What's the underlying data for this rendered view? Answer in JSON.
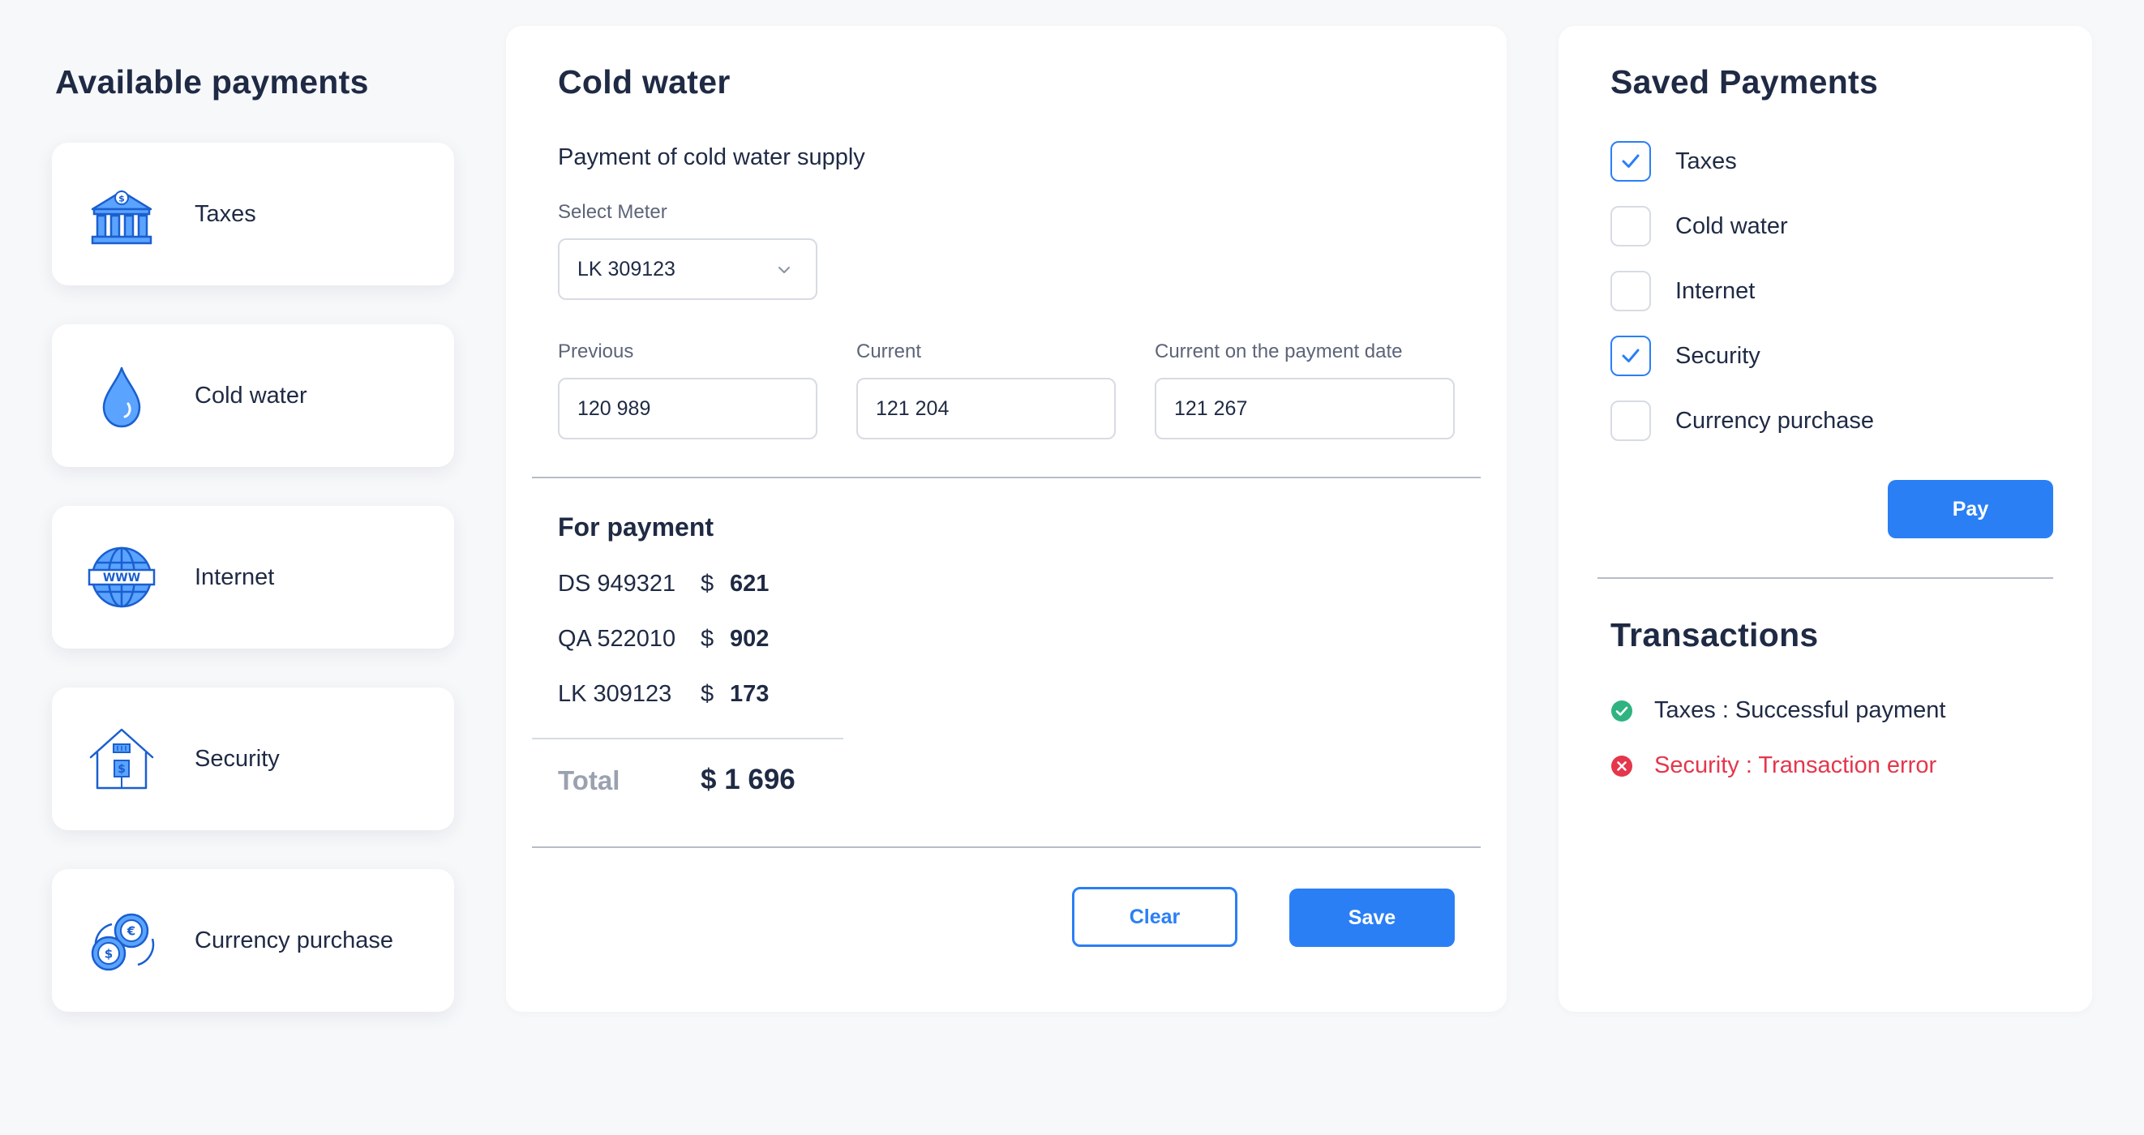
{
  "available_payments": {
    "title": "Available payments",
    "items": [
      {
        "label": "Taxes",
        "icon": "bank-icon"
      },
      {
        "label": "Cold water",
        "icon": "water-drop-icon"
      },
      {
        "label": "Internet",
        "icon": "globe-www-icon"
      },
      {
        "label": "Security",
        "icon": "house-safe-icon"
      },
      {
        "label": "Currency purchase",
        "icon": "coins-icon"
      }
    ]
  },
  "detail": {
    "title": "Cold water",
    "subtitle": "Payment of cold water supply",
    "meter": {
      "label": "Select Meter",
      "value": "LK 309123"
    },
    "readings": {
      "previous": {
        "label": "Previous",
        "value": "120 989"
      },
      "current": {
        "label": "Current",
        "value": "121 204"
      },
      "current_on_date": {
        "label": "Current on the payment date",
        "value": "121 267"
      }
    },
    "for_payment": {
      "title": "For payment",
      "rows": [
        {
          "id": "DS 949321",
          "currency": "$",
          "amount": "621"
        },
        {
          "id": "QA 522010",
          "currency": "$",
          "amount": "902"
        },
        {
          "id": "LK 309123",
          "currency": "$",
          "amount": "173"
        }
      ],
      "total_label": "Total",
      "total_value": "$ 1 696"
    },
    "buttons": {
      "clear": "Clear",
      "save": "Save"
    }
  },
  "saved_payments": {
    "title": "Saved Payments",
    "items": [
      {
        "label": "Taxes",
        "checked": true
      },
      {
        "label": "Cold water",
        "checked": false
      },
      {
        "label": "Internet",
        "checked": false
      },
      {
        "label": "Security",
        "checked": true
      },
      {
        "label": "Currency purchase",
        "checked": false
      }
    ],
    "pay_button": "Pay"
  },
  "transactions": {
    "title": "Transactions",
    "items": [
      {
        "text": "Taxes : Successful payment",
        "status": "success",
        "color": "#2fb380"
      },
      {
        "text": "Security : Transaction error",
        "status": "error",
        "color": "#e5364b"
      }
    ]
  },
  "colors": {
    "accent": "#2a7ff5",
    "text": "#1f2a44",
    "background": "#f7f8fa"
  }
}
